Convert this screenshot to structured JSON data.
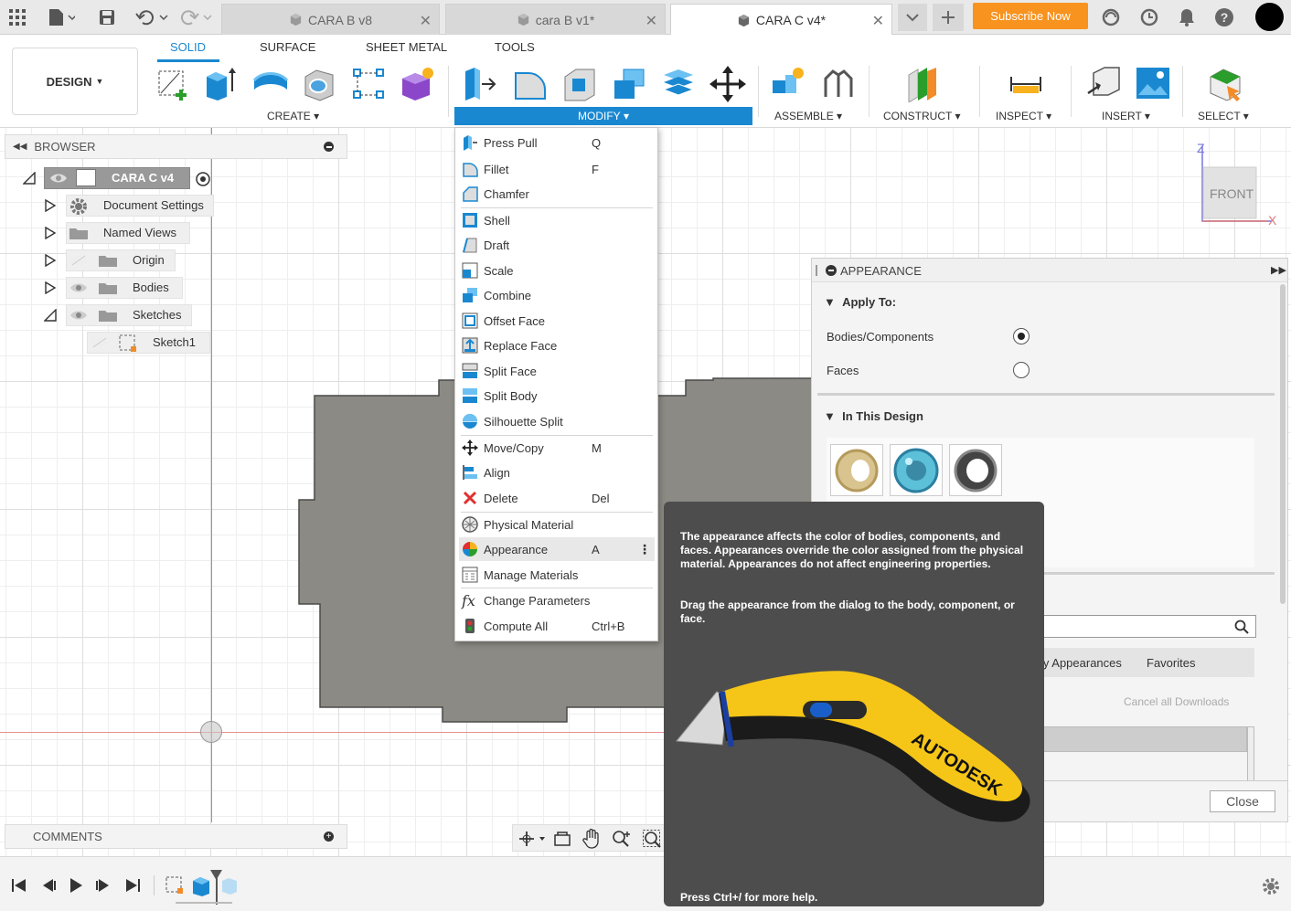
{
  "tabs": [
    {
      "label": "CARA B v8",
      "active": false
    },
    {
      "label": "cara B v1*",
      "active": false
    },
    {
      "label": "CARA C v4*",
      "active": true
    }
  ],
  "subscribe": "Subscribe Now",
  "toolbar_tabs": [
    "SOLID",
    "SURFACE",
    "SHEET METAL",
    "TOOLS"
  ],
  "design": "DESIGN",
  "groups": {
    "create": "CREATE",
    "modify": "MODIFY",
    "assemble": "ASSEMBLE",
    "construct": "CONSTRUCT",
    "inspect": "INSPECT",
    "insert": "INSERT",
    "select": "SELECT"
  },
  "browser": {
    "title": "BROWSER",
    "root": "CARA C v4",
    "items": [
      "Document Settings",
      "Named Views",
      "Origin",
      "Bodies",
      "Sketches",
      "Sketch1"
    ]
  },
  "menu": [
    {
      "label": "Press Pull",
      "shortcut": "Q"
    },
    {
      "label": "Fillet",
      "shortcut": "F"
    },
    {
      "label": "Chamfer",
      "shortcut": ""
    },
    {
      "label": "Shell",
      "shortcut": ""
    },
    {
      "label": "Draft",
      "shortcut": ""
    },
    {
      "label": "Scale",
      "shortcut": ""
    },
    {
      "label": "Combine",
      "shortcut": ""
    },
    {
      "label": "Offset Face",
      "shortcut": ""
    },
    {
      "label": "Replace Face",
      "shortcut": ""
    },
    {
      "label": "Split Face",
      "shortcut": ""
    },
    {
      "label": "Split Body",
      "shortcut": ""
    },
    {
      "label": "Silhouette Split",
      "shortcut": ""
    },
    {
      "label": "Move/Copy",
      "shortcut": "M"
    },
    {
      "label": "Align",
      "shortcut": ""
    },
    {
      "label": "Delete",
      "shortcut": "Del"
    },
    {
      "label": "Physical Material",
      "shortcut": ""
    },
    {
      "label": "Appearance",
      "shortcut": "A"
    },
    {
      "label": "Manage Materials",
      "shortcut": ""
    },
    {
      "label": "Change Parameters",
      "shortcut": ""
    },
    {
      "label": "Compute All",
      "shortcut": "Ctrl+B"
    }
  ],
  "viewcube": {
    "face": "FRONT",
    "z": "Z",
    "x": "X"
  },
  "appearance": {
    "title": "APPEARANCE",
    "apply_to": "Apply To:",
    "opt_bodies": "Bodies/Components",
    "opt_faces": "Faces",
    "in_design": "In This Design",
    "tab_my": "ly Appearances",
    "tab_fav": "Favorites",
    "cancel": "Cancel all Downloads",
    "close": "Close"
  },
  "tooltip": {
    "p1": "The appearance affects the color of bodies, components, and faces. Appearances override the color assigned from the physical material. Appearances do not affect engineering properties.",
    "p2": "Drag the appearance from the dialog to the body, component, or face.",
    "help": "Press Ctrl+/ for more help.",
    "brand": "AUTODESK"
  },
  "comments": "COMMENTS",
  "colors": {
    "accent": "#1a88d1",
    "orange": "#f7931e",
    "tooltip": "#4d4d4d",
    "body": "#8c8a84"
  }
}
